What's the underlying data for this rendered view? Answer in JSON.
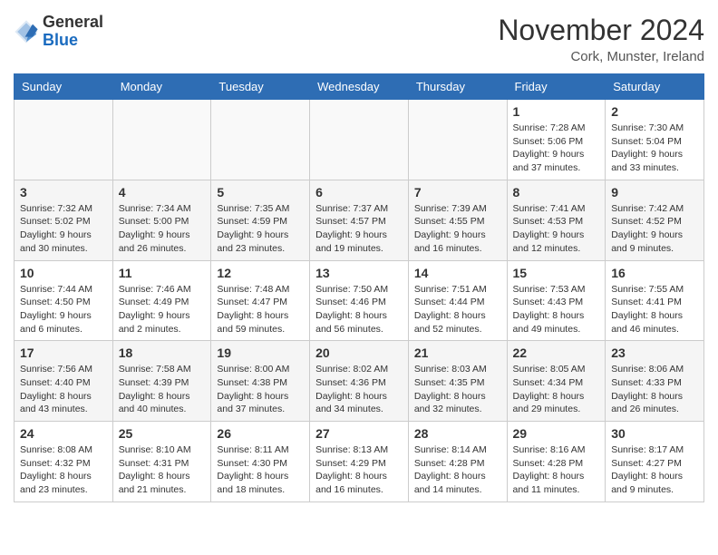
{
  "header": {
    "logo_general": "General",
    "logo_blue": "Blue",
    "title": "November 2024",
    "location": "Cork, Munster, Ireland"
  },
  "days_of_week": [
    "Sunday",
    "Monday",
    "Tuesday",
    "Wednesday",
    "Thursday",
    "Friday",
    "Saturday"
  ],
  "weeks": [
    [
      {
        "day": "",
        "info": "",
        "empty": true
      },
      {
        "day": "",
        "info": "",
        "empty": true
      },
      {
        "day": "",
        "info": "",
        "empty": true
      },
      {
        "day": "",
        "info": "",
        "empty": true
      },
      {
        "day": "",
        "info": "",
        "empty": true
      },
      {
        "day": "1",
        "info": "Sunrise: 7:28 AM\nSunset: 5:06 PM\nDaylight: 9 hours and 37 minutes."
      },
      {
        "day": "2",
        "info": "Sunrise: 7:30 AM\nSunset: 5:04 PM\nDaylight: 9 hours and 33 minutes."
      }
    ],
    [
      {
        "day": "3",
        "info": "Sunrise: 7:32 AM\nSunset: 5:02 PM\nDaylight: 9 hours and 30 minutes."
      },
      {
        "day": "4",
        "info": "Sunrise: 7:34 AM\nSunset: 5:00 PM\nDaylight: 9 hours and 26 minutes."
      },
      {
        "day": "5",
        "info": "Sunrise: 7:35 AM\nSunset: 4:59 PM\nDaylight: 9 hours and 23 minutes."
      },
      {
        "day": "6",
        "info": "Sunrise: 7:37 AM\nSunset: 4:57 PM\nDaylight: 9 hours and 19 minutes."
      },
      {
        "day": "7",
        "info": "Sunrise: 7:39 AM\nSunset: 4:55 PM\nDaylight: 9 hours and 16 minutes."
      },
      {
        "day": "8",
        "info": "Sunrise: 7:41 AM\nSunset: 4:53 PM\nDaylight: 9 hours and 12 minutes."
      },
      {
        "day": "9",
        "info": "Sunrise: 7:42 AM\nSunset: 4:52 PM\nDaylight: 9 hours and 9 minutes."
      }
    ],
    [
      {
        "day": "10",
        "info": "Sunrise: 7:44 AM\nSunset: 4:50 PM\nDaylight: 9 hours and 6 minutes."
      },
      {
        "day": "11",
        "info": "Sunrise: 7:46 AM\nSunset: 4:49 PM\nDaylight: 9 hours and 2 minutes."
      },
      {
        "day": "12",
        "info": "Sunrise: 7:48 AM\nSunset: 4:47 PM\nDaylight: 8 hours and 59 minutes."
      },
      {
        "day": "13",
        "info": "Sunrise: 7:50 AM\nSunset: 4:46 PM\nDaylight: 8 hours and 56 minutes."
      },
      {
        "day": "14",
        "info": "Sunrise: 7:51 AM\nSunset: 4:44 PM\nDaylight: 8 hours and 52 minutes."
      },
      {
        "day": "15",
        "info": "Sunrise: 7:53 AM\nSunset: 4:43 PM\nDaylight: 8 hours and 49 minutes."
      },
      {
        "day": "16",
        "info": "Sunrise: 7:55 AM\nSunset: 4:41 PM\nDaylight: 8 hours and 46 minutes."
      }
    ],
    [
      {
        "day": "17",
        "info": "Sunrise: 7:56 AM\nSunset: 4:40 PM\nDaylight: 8 hours and 43 minutes."
      },
      {
        "day": "18",
        "info": "Sunrise: 7:58 AM\nSunset: 4:39 PM\nDaylight: 8 hours and 40 minutes."
      },
      {
        "day": "19",
        "info": "Sunrise: 8:00 AM\nSunset: 4:38 PM\nDaylight: 8 hours and 37 minutes."
      },
      {
        "day": "20",
        "info": "Sunrise: 8:02 AM\nSunset: 4:36 PM\nDaylight: 8 hours and 34 minutes."
      },
      {
        "day": "21",
        "info": "Sunrise: 8:03 AM\nSunset: 4:35 PM\nDaylight: 8 hours and 32 minutes."
      },
      {
        "day": "22",
        "info": "Sunrise: 8:05 AM\nSunset: 4:34 PM\nDaylight: 8 hours and 29 minutes."
      },
      {
        "day": "23",
        "info": "Sunrise: 8:06 AM\nSunset: 4:33 PM\nDaylight: 8 hours and 26 minutes."
      }
    ],
    [
      {
        "day": "24",
        "info": "Sunrise: 8:08 AM\nSunset: 4:32 PM\nDaylight: 8 hours and 23 minutes."
      },
      {
        "day": "25",
        "info": "Sunrise: 8:10 AM\nSunset: 4:31 PM\nDaylight: 8 hours and 21 minutes."
      },
      {
        "day": "26",
        "info": "Sunrise: 8:11 AM\nSunset: 4:30 PM\nDaylight: 8 hours and 18 minutes."
      },
      {
        "day": "27",
        "info": "Sunrise: 8:13 AM\nSunset: 4:29 PM\nDaylight: 8 hours and 16 minutes."
      },
      {
        "day": "28",
        "info": "Sunrise: 8:14 AM\nSunset: 4:28 PM\nDaylight: 8 hours and 14 minutes."
      },
      {
        "day": "29",
        "info": "Sunrise: 8:16 AM\nSunset: 4:28 PM\nDaylight: 8 hours and 11 minutes."
      },
      {
        "day": "30",
        "info": "Sunrise: 8:17 AM\nSunset: 4:27 PM\nDaylight: 8 hours and 9 minutes."
      }
    ]
  ]
}
